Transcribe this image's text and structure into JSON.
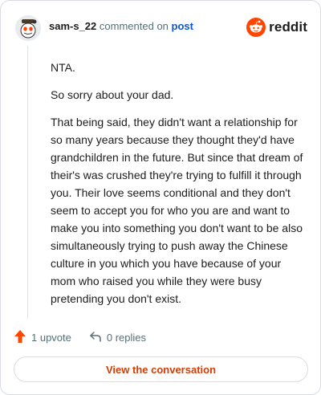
{
  "header": {
    "username": "sam-s_22",
    "commented_text": "commented on",
    "post_link": "post",
    "brand_name": "reddit",
    "brand_color": "#ff4500"
  },
  "comment": {
    "paragraphs": [
      "NTA.",
      "So sorry about your dad.",
      "That being said, they didn't want a relationship for so many years because they thought they'd have grandchildren in the future. But since that dream of their's was crushed they're trying to fulfill it through you. Their love seems conditional and they don't seem to accept you for who you are and want to make you into something you don't want to be also simultaneously trying to push away the Chinese culture in you which you have because of your mom who raised you while they were busy pretending you don't exist."
    ]
  },
  "actions": {
    "upvote_label": "1 upvote",
    "replies_label": "0 replies",
    "upvote_icon": "upvote-arrow-icon",
    "reply_icon": "reply-arrow-icon"
  },
  "footer": {
    "view_button_label": "View the conversation",
    "accent_color": "#d93a00"
  }
}
